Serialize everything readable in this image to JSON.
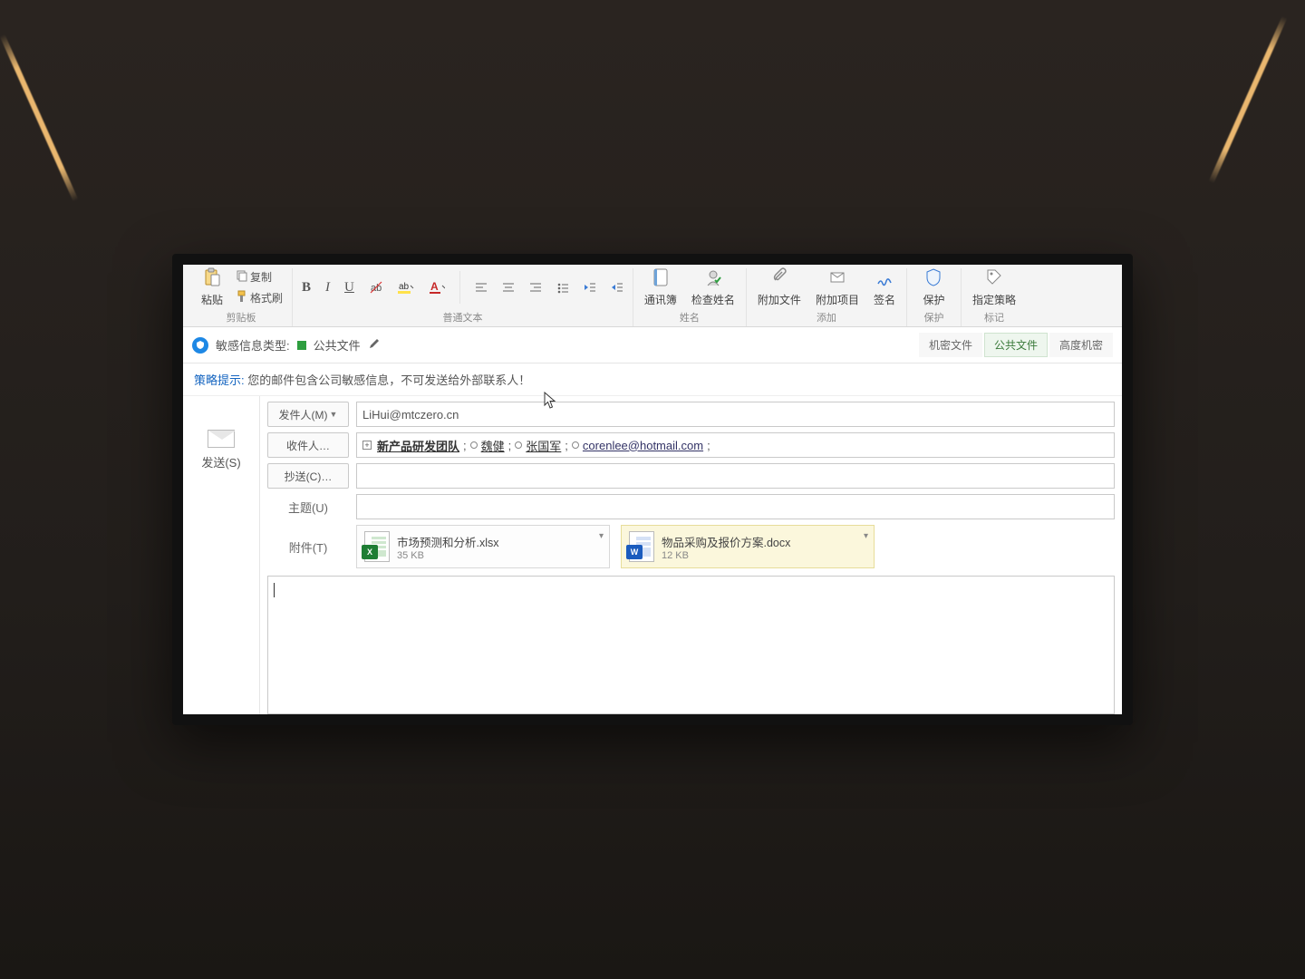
{
  "ribbon": {
    "clipboard": {
      "paste": "粘贴",
      "copy": "复制",
      "format_painter": "格式刷",
      "group": "剪贴板"
    },
    "basic_text": {
      "group": "普通文本"
    },
    "names": {
      "address_book": "通讯簿",
      "check_names": "检查姓名",
      "group": "姓名"
    },
    "include": {
      "attach_file": "附加文件",
      "attach_item": "附加项目",
      "signature": "签名",
      "group": "添加"
    },
    "protect": {
      "protect": "保护",
      "group": "保护"
    },
    "tags": {
      "assign_policy": "指定策略",
      "group": "标记"
    }
  },
  "sensitivity": {
    "label": "敏感信息类型:",
    "value": "公共文件",
    "tabs": {
      "confidential": "机密文件",
      "public": "公共文件",
      "highly": "高度机密"
    }
  },
  "policy": {
    "lead": "策略提示:",
    "text": "您的邮件包含公司敏感信息，不可发送给外部联系人！"
  },
  "compose": {
    "send": "发送(S)",
    "from_label": "发件人(M)",
    "from_value": "LiHui@mtczero.cn",
    "to_label": "收件人…",
    "cc_label": "抄送(C)…",
    "subject_label": "主题(U)",
    "attach_label": "附件(T)",
    "recipients": {
      "group": "新产品研发团队",
      "r1": "魏健",
      "r2": "张国军",
      "r3": "corenlee@hotmail.com"
    },
    "attachments": [
      {
        "name": "市场预测和分析.xlsx",
        "size": "35 KB",
        "type": "excel"
      },
      {
        "name": "物品采购及报价方案.docx",
        "size": "12 KB",
        "type": "word"
      }
    ]
  }
}
